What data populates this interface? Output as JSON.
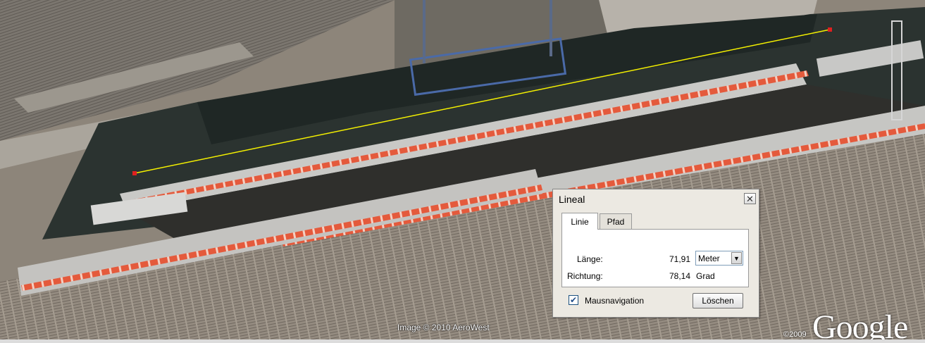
{
  "ruler_dialog": {
    "title": "Lineal",
    "close_glyph": "✕",
    "tabs": [
      {
        "label": "Linie",
        "active": true
      },
      {
        "label": "Pfad",
        "active": false
      }
    ],
    "length_label": "Länge:",
    "length_value": "71,91",
    "unit_selected": "Meter",
    "direction_label": "Richtung:",
    "direction_value": "78,14",
    "direction_unit": "Grad",
    "mouse_nav_label": "Mausnavigation",
    "mouse_nav_checked": true,
    "clear_button": "Löschen"
  },
  "map": {
    "imagery_credit": "Image © 2010 AeroWest",
    "copyright": "©2009",
    "logo": "Google",
    "measure_line_color": "#f4f000",
    "train_accent_color": "#e04a32"
  },
  "icons": {
    "checkbox": "check-icon",
    "dropdown": "chevron-down-icon",
    "close": "close-icon"
  }
}
